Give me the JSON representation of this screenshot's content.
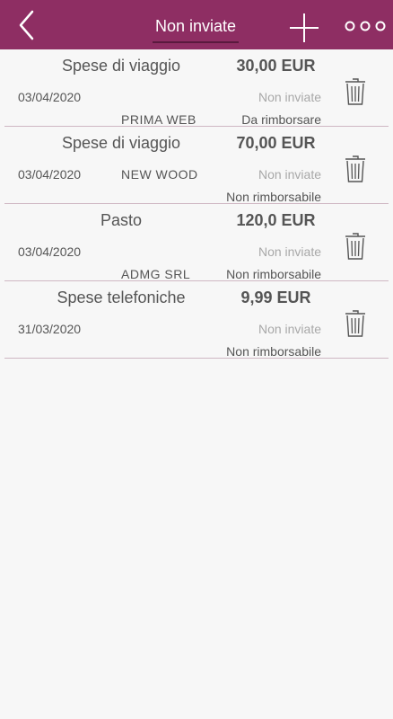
{
  "header": {
    "title": "Non inviate",
    "back_icon": "chevron-left-icon",
    "add_icon": "plus-icon",
    "more_icon": "more-options-icon",
    "brand_color": "#8e2e63"
  },
  "expenses": [
    {
      "name": "Spese di viaggio",
      "amount": "30,00 EUR",
      "date": "03/04/2020",
      "company": "PRIMA WEB",
      "status": "Non inviate",
      "refund": "Da rimborsare"
    },
    {
      "name": "Spese di viaggio",
      "amount": "70,00 EUR",
      "date": "03/04/2020",
      "company": "NEW  WOOD",
      "status": "Non inviate",
      "refund": "Non rimborsabile"
    },
    {
      "name": "Pasto",
      "amount": "120,0 EUR",
      "date": "03/04/2020",
      "company": "ADMG SRL",
      "status": "Non inviate",
      "refund": "Non rimborsabile"
    },
    {
      "name": "Spese telefoniche",
      "amount": "9,99 EUR",
      "date": "31/03/2020",
      "company": "",
      "status": "Non inviate",
      "refund": "Non rimborsabile"
    }
  ]
}
